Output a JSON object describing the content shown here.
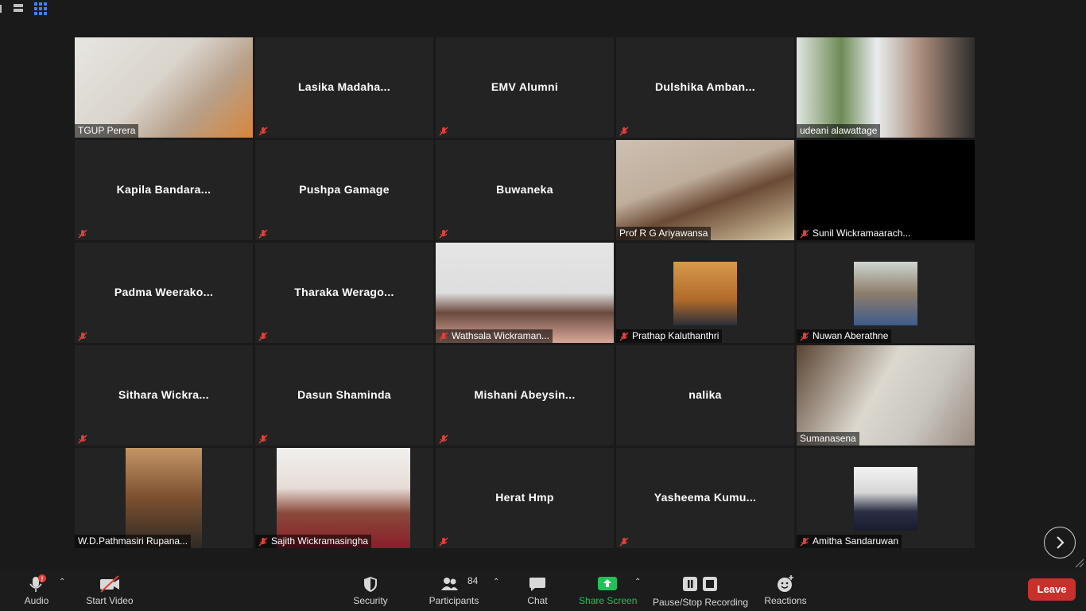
{
  "participants": [
    {
      "name": "TGUP Perera",
      "video": true,
      "muted": false
    },
    {
      "name": "Lasika  Madaha...",
      "video": false,
      "muted": true
    },
    {
      "name": "EMV Alumni",
      "video": false,
      "muted": true
    },
    {
      "name": "Dulshika  Amban...",
      "video": false,
      "muted": true
    },
    {
      "name": "udeani alawattage",
      "video": true,
      "muted": false
    },
    {
      "name": "Kapila  Bandara...",
      "video": false,
      "muted": true
    },
    {
      "name": "Pushpa Gamage",
      "video": false,
      "muted": true
    },
    {
      "name": "Buwaneka",
      "video": false,
      "muted": true
    },
    {
      "name": "Prof R G Ariyawansa",
      "video": true,
      "muted": false
    },
    {
      "name": "Sunil Wickramaarach...",
      "video": false,
      "muted": true,
      "black": true
    },
    {
      "name": "Padma  Weerako...",
      "video": false,
      "muted": true
    },
    {
      "name": "Tharaka  Werago...",
      "video": false,
      "muted": true
    },
    {
      "name": "Wathsala Wickraman...",
      "video": true,
      "muted": true
    },
    {
      "name": "Prathap Kaluthanthri",
      "video": true,
      "muted": true
    },
    {
      "name": "Nuwan Aberathne",
      "video": true,
      "muted": true
    },
    {
      "name": "Sithara  Wickra...",
      "video": false,
      "muted": true
    },
    {
      "name": "Dasun Shaminda",
      "video": false,
      "muted": true
    },
    {
      "name": "Mishani  Abeysin...",
      "video": false,
      "muted": true
    },
    {
      "name": "nalika",
      "video": false,
      "muted": false
    },
    {
      "name": "Sumanasena",
      "video": true,
      "muted": false
    },
    {
      "name": "W.D.Pathmasiri Rupana...",
      "video": true,
      "muted": false
    },
    {
      "name": "Sajith Wickramasingha",
      "video": true,
      "muted": true
    },
    {
      "name": "Herat Hmp",
      "video": false,
      "muted": true
    },
    {
      "name": "Yasheema  Kumu...",
      "video": false,
      "muted": true
    },
    {
      "name": "Amitha Sandaruwan",
      "video": true,
      "muted": true
    }
  ],
  "toolbar": {
    "audio": "Audio",
    "start_video": "Start Video",
    "security": "Security",
    "participants": "Participants",
    "participants_count": "84",
    "chat": "Chat",
    "share_screen": "Share Screen",
    "recording": "Pause/Stop Recording",
    "reactions": "Reactions",
    "leave": "Leave"
  },
  "colors": {
    "background": "#1a1a1a",
    "tile": "#232323",
    "leave": "#c8302c",
    "share_green": "#21c05a",
    "mute_red": "#e0403a",
    "view_active": "#3b82f6"
  }
}
